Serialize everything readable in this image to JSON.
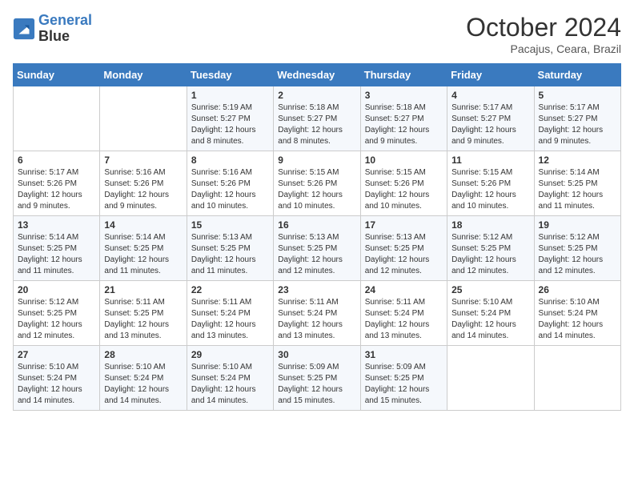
{
  "header": {
    "logo_line1": "General",
    "logo_line2": "Blue",
    "month_year": "October 2024",
    "location": "Pacajus, Ceara, Brazil"
  },
  "days_of_week": [
    "Sunday",
    "Monday",
    "Tuesday",
    "Wednesday",
    "Thursday",
    "Friday",
    "Saturday"
  ],
  "weeks": [
    [
      {
        "day": "",
        "info": ""
      },
      {
        "day": "",
        "info": ""
      },
      {
        "day": "1",
        "info": "Sunrise: 5:19 AM\nSunset: 5:27 PM\nDaylight: 12 hours and 8 minutes."
      },
      {
        "day": "2",
        "info": "Sunrise: 5:18 AM\nSunset: 5:27 PM\nDaylight: 12 hours and 8 minutes."
      },
      {
        "day": "3",
        "info": "Sunrise: 5:18 AM\nSunset: 5:27 PM\nDaylight: 12 hours and 9 minutes."
      },
      {
        "day": "4",
        "info": "Sunrise: 5:17 AM\nSunset: 5:27 PM\nDaylight: 12 hours and 9 minutes."
      },
      {
        "day": "5",
        "info": "Sunrise: 5:17 AM\nSunset: 5:27 PM\nDaylight: 12 hours and 9 minutes."
      }
    ],
    [
      {
        "day": "6",
        "info": "Sunrise: 5:17 AM\nSunset: 5:26 PM\nDaylight: 12 hours and 9 minutes."
      },
      {
        "day": "7",
        "info": "Sunrise: 5:16 AM\nSunset: 5:26 PM\nDaylight: 12 hours and 9 minutes."
      },
      {
        "day": "8",
        "info": "Sunrise: 5:16 AM\nSunset: 5:26 PM\nDaylight: 12 hours and 10 minutes."
      },
      {
        "day": "9",
        "info": "Sunrise: 5:15 AM\nSunset: 5:26 PM\nDaylight: 12 hours and 10 minutes."
      },
      {
        "day": "10",
        "info": "Sunrise: 5:15 AM\nSunset: 5:26 PM\nDaylight: 12 hours and 10 minutes."
      },
      {
        "day": "11",
        "info": "Sunrise: 5:15 AM\nSunset: 5:26 PM\nDaylight: 12 hours and 10 minutes."
      },
      {
        "day": "12",
        "info": "Sunrise: 5:14 AM\nSunset: 5:25 PM\nDaylight: 12 hours and 11 minutes."
      }
    ],
    [
      {
        "day": "13",
        "info": "Sunrise: 5:14 AM\nSunset: 5:25 PM\nDaylight: 12 hours and 11 minutes."
      },
      {
        "day": "14",
        "info": "Sunrise: 5:14 AM\nSunset: 5:25 PM\nDaylight: 12 hours and 11 minutes."
      },
      {
        "day": "15",
        "info": "Sunrise: 5:13 AM\nSunset: 5:25 PM\nDaylight: 12 hours and 11 minutes."
      },
      {
        "day": "16",
        "info": "Sunrise: 5:13 AM\nSunset: 5:25 PM\nDaylight: 12 hours and 12 minutes."
      },
      {
        "day": "17",
        "info": "Sunrise: 5:13 AM\nSunset: 5:25 PM\nDaylight: 12 hours and 12 minutes."
      },
      {
        "day": "18",
        "info": "Sunrise: 5:12 AM\nSunset: 5:25 PM\nDaylight: 12 hours and 12 minutes."
      },
      {
        "day": "19",
        "info": "Sunrise: 5:12 AM\nSunset: 5:25 PM\nDaylight: 12 hours and 12 minutes."
      }
    ],
    [
      {
        "day": "20",
        "info": "Sunrise: 5:12 AM\nSunset: 5:25 PM\nDaylight: 12 hours and 12 minutes."
      },
      {
        "day": "21",
        "info": "Sunrise: 5:11 AM\nSunset: 5:25 PM\nDaylight: 12 hours and 13 minutes."
      },
      {
        "day": "22",
        "info": "Sunrise: 5:11 AM\nSunset: 5:24 PM\nDaylight: 12 hours and 13 minutes."
      },
      {
        "day": "23",
        "info": "Sunrise: 5:11 AM\nSunset: 5:24 PM\nDaylight: 12 hours and 13 minutes."
      },
      {
        "day": "24",
        "info": "Sunrise: 5:11 AM\nSunset: 5:24 PM\nDaylight: 12 hours and 13 minutes."
      },
      {
        "day": "25",
        "info": "Sunrise: 5:10 AM\nSunset: 5:24 PM\nDaylight: 12 hours and 14 minutes."
      },
      {
        "day": "26",
        "info": "Sunrise: 5:10 AM\nSunset: 5:24 PM\nDaylight: 12 hours and 14 minutes."
      }
    ],
    [
      {
        "day": "27",
        "info": "Sunrise: 5:10 AM\nSunset: 5:24 PM\nDaylight: 12 hours and 14 minutes."
      },
      {
        "day": "28",
        "info": "Sunrise: 5:10 AM\nSunset: 5:24 PM\nDaylight: 12 hours and 14 minutes."
      },
      {
        "day": "29",
        "info": "Sunrise: 5:10 AM\nSunset: 5:24 PM\nDaylight: 12 hours and 14 minutes."
      },
      {
        "day": "30",
        "info": "Sunrise: 5:09 AM\nSunset: 5:25 PM\nDaylight: 12 hours and 15 minutes."
      },
      {
        "day": "31",
        "info": "Sunrise: 5:09 AM\nSunset: 5:25 PM\nDaylight: 12 hours and 15 minutes."
      },
      {
        "day": "",
        "info": ""
      },
      {
        "day": "",
        "info": ""
      }
    ]
  ]
}
